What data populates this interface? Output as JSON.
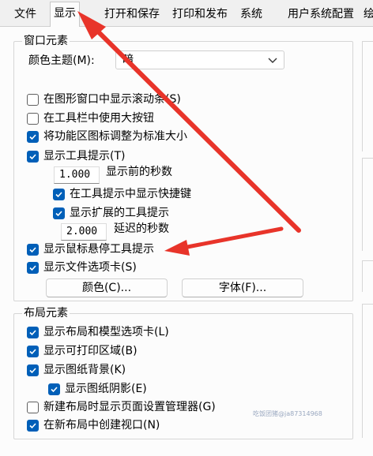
{
  "tabs": [
    {
      "label": "文件",
      "active": false
    },
    {
      "label": "显示",
      "active": true
    },
    {
      "label": "打开和保存",
      "active": false
    },
    {
      "label": "打印和发布",
      "active": false
    },
    {
      "label": "系统",
      "active": false
    },
    {
      "label": "用户系统配置",
      "active": false
    },
    {
      "label": "绘",
      "active": false
    }
  ],
  "window_elements": {
    "title": "窗口元素",
    "color_theme_label": "颜色主题(M):",
    "color_theme_value": "暗",
    "checkboxes": [
      {
        "label": "在图形窗口中显示滚动条(S)",
        "checked": false
      },
      {
        "label": "在工具栏中使用大按钮",
        "checked": false
      },
      {
        "label": "将功能区图标调整为标准大小",
        "checked": true
      },
      {
        "label": "显示工具提示(T)",
        "checked": true
      }
    ],
    "tooltip_delay_value": "1.000",
    "tooltip_delay_label": "显示前的秒数",
    "show_shortcut": {
      "label": "在工具提示中显示快捷键",
      "checked": true
    },
    "show_extended": {
      "label": "显示扩展的工具提示",
      "checked": true
    },
    "extended_delay_value": "2.000",
    "extended_delay_label": "延迟的秒数",
    "show_rollover": {
      "label": "显示鼠标悬停工具提示",
      "checked": true
    },
    "show_file_tabs": {
      "label": "显示文件选项卡(S)",
      "checked": true
    },
    "colors_button": "颜色(C)...",
    "fonts_button": "字体(F)..."
  },
  "layout_elements": {
    "title": "布局元素",
    "checkboxes": [
      {
        "label": "显示布局和模型选项卡(L)",
        "checked": true
      },
      {
        "label": "显示可打印区域(B)",
        "checked": true
      },
      {
        "label": "显示图纸背景(K)",
        "checked": true
      }
    ],
    "show_shadow": {
      "label": "显示图纸阴影(E)",
      "checked": true
    },
    "checkboxes2": [
      {
        "label": "新建布局时显示页面设置管理器(G)",
        "checked": false
      },
      {
        "label": "在新布局中创建视口(N)",
        "checked": true
      }
    ]
  },
  "watermark": "吃饭团猪@ja87314968",
  "accent_color": "#005fb8",
  "annotation_color": "#e8342a"
}
